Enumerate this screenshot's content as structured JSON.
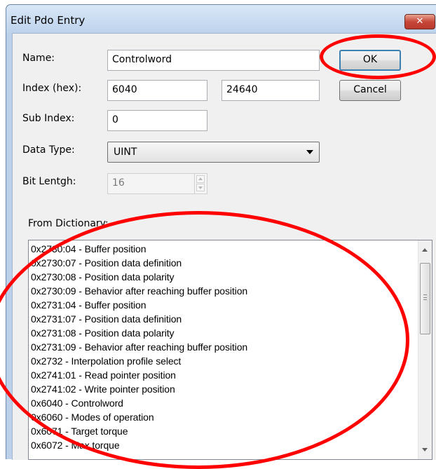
{
  "window": {
    "title": "Edit Pdo Entry",
    "close_glyph": "✕"
  },
  "form": {
    "name_label": "Name:",
    "name_value": "Controlword",
    "index_label": "Index (hex):",
    "index_value": "6040",
    "index_decimal": "24640",
    "subindex_label": "Sub Index:",
    "subindex_value": "0",
    "datatype_label": "Data Type:",
    "datatype_value": "UINT",
    "bitlength_label": "Bit Lentgh:",
    "bitlength_value": "16"
  },
  "buttons": {
    "ok": "OK",
    "cancel": "Cancel"
  },
  "dictionary": {
    "label": "From Dictionary:",
    "items": [
      "0x2730:04 - Buffer position",
      "0x2730:07 - Position data definition",
      "0x2730:08 - Position data polarity",
      "0x2730:09 - Behavior after reaching buffer position",
      "0x2731:04 - Buffer position",
      "0x2731:07 - Position data definition",
      "0x2731:08 - Position data polarity",
      "0x2731:09 - Behavior after reaching buffer position",
      "0x2732 - Interpolation profile select",
      "0x2741:01 - Read pointer position",
      "0x2741:02 - Write pointer position",
      "0x6040 - Controlword",
      "0x6060 - Modes of operation",
      "0x6071 - Target torque",
      "0x6072 - Max torque"
    ]
  },
  "colors": {
    "annotation": "#ff0000",
    "close_button": "#c7483a",
    "default_button_border": "#3c7fb1"
  }
}
